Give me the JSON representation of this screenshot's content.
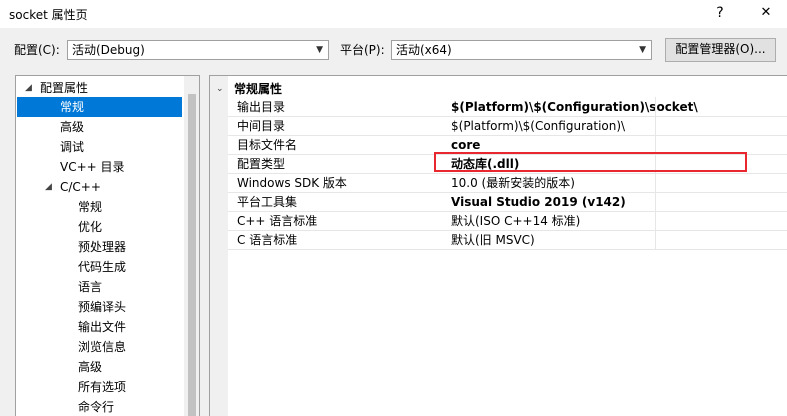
{
  "window": {
    "title": "socket 属性页",
    "help": "?",
    "close": "✕"
  },
  "toolbar": {
    "config_label": "配置(C):",
    "config_value": "活动(Debug)",
    "platform_label": "平台(P):",
    "platform_value": "活动(x64)",
    "manager_button": "配置管理器(O)..."
  },
  "tree": {
    "root": "配置属性",
    "items": [
      {
        "label": "常规",
        "selected": true
      },
      {
        "label": "高级"
      },
      {
        "label": "调试"
      },
      {
        "label": "VC++ 目录"
      }
    ],
    "cpp": {
      "label": "C/C++",
      "children": [
        "常规",
        "优化",
        "预处理器",
        "代码生成",
        "语言",
        "预编译头",
        "输出文件",
        "浏览信息",
        "高级",
        "所有选项",
        "命令行"
      ]
    }
  },
  "grid": {
    "group": "常规属性",
    "rows": [
      {
        "key": "输出目录",
        "value": "$(Platform)\\$(Configuration)\\socket\\",
        "bold": true
      },
      {
        "key": "中间目录",
        "value": "$(Platform)\\$(Configuration)\\",
        "bold": false
      },
      {
        "key": "目标文件名",
        "value": "core",
        "bold": true
      },
      {
        "key": "配置类型",
        "value": "动态库(.dll)",
        "bold": true
      },
      {
        "key": "Windows SDK 版本",
        "value": "10.0 (最新安装的版本)",
        "bold": false
      },
      {
        "key": "平台工具集",
        "value": "Visual Studio 2019 (v142)",
        "bold": true
      },
      {
        "key": "C++ 语言标准",
        "value": "默认(ISO C++14 标准)",
        "bold": false
      },
      {
        "key": "C 语言标准",
        "value": "默认(旧 MSVC)",
        "bold": false
      }
    ]
  },
  "colors": {
    "selection": "#0078d7",
    "highlight_box": "#e8272f"
  }
}
